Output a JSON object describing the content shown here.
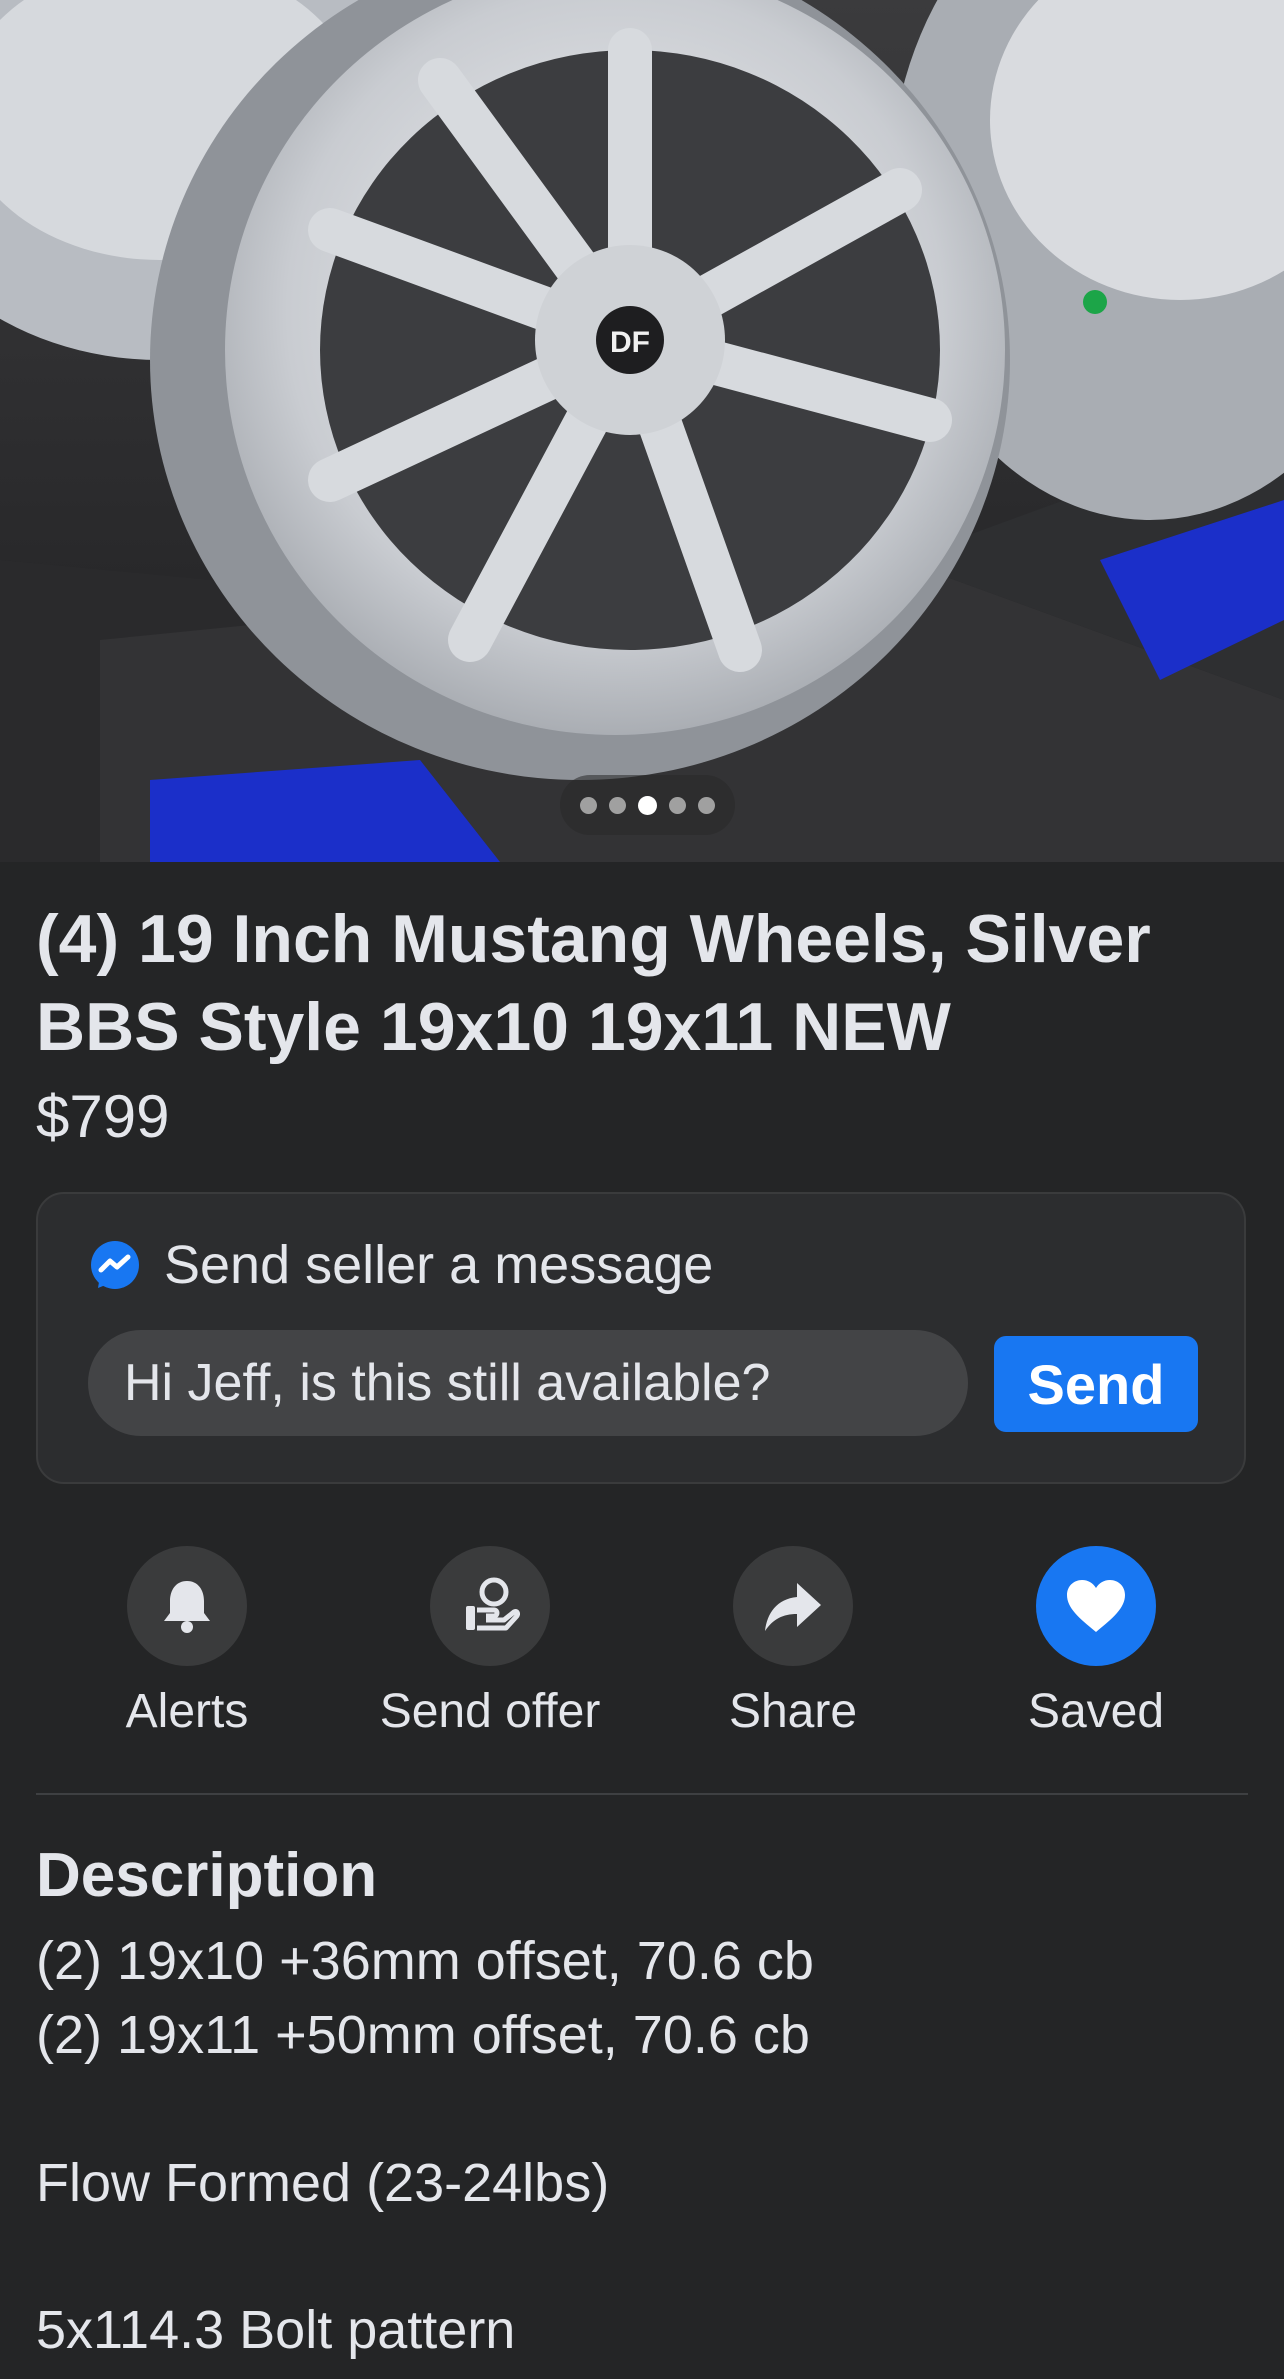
{
  "hero": {
    "image_description": "",
    "carousel": {
      "count": 5,
      "active_index": 2
    }
  },
  "listing": {
    "title": "(4) 19 Inch Mustang Wheels, Silver BBS Style 19x10 19x11 NEW",
    "price": "$799"
  },
  "message": {
    "heading": "Send seller a message",
    "input_value": "Hi Jeff, is this still available?",
    "send_label": "Send"
  },
  "actions": [
    {
      "label": "Alerts",
      "icon": "bell-icon"
    },
    {
      "label": "Send offer",
      "icon": "offer-hand-icon"
    },
    {
      "label": "Share",
      "icon": "share-arrow-icon"
    },
    {
      "label": "Saved",
      "icon": "heart-icon"
    }
  ],
  "description": {
    "heading": "Description",
    "lines": [
      "(2) 19x10 +36mm offset, 70.6 cb",
      "(2) 19x11 +50mm offset, 70.6 cb",
      "Flow Formed (23-24lbs)",
      "5x114.3 Bolt pattern"
    ]
  },
  "colors": {
    "background": "#242526",
    "accent": "#1877f2",
    "text": "#e4e6eb"
  }
}
